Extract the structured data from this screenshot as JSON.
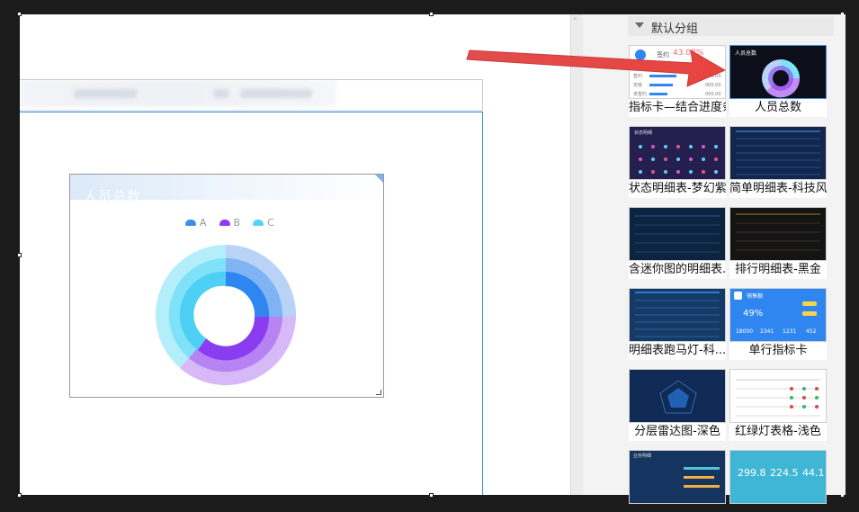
{
  "canvas": {
    "widget": {
      "title": "人员总数",
      "legend": [
        {
          "label": "A",
          "color": "#3a8ef0"
        },
        {
          "label": "B",
          "color": "#8a3df0"
        },
        {
          "label": "C",
          "color": "#54d3f5"
        }
      ]
    }
  },
  "panel": {
    "group_label": "默认分组",
    "tiles": [
      {
        "label": "指标卡—结合进度条",
        "thumb_text": {
          "name": "签约",
          "pct": "43.08%",
          "rows": [
            "签约",
            "定级",
            "未签约"
          ],
          "val": "000.00"
        }
      },
      {
        "label": "人员总数",
        "thumb_text": {
          "title": "人员总数"
        }
      },
      {
        "label": "状态明细表-梦幻紫",
        "thumb_text": {
          "title": "状态明细"
        }
      },
      {
        "label": "简单明细表-科技风"
      },
      {
        "label": "含迷你图的明细表..."
      },
      {
        "label": "排行明细表-黑金"
      },
      {
        "label": "明细表跑马灯-科..."
      },
      {
        "label": "单行指标卡",
        "thumb_text": {
          "name": "销售额",
          "pct": "49%",
          "nums": [
            "18000",
            "2341",
            "1231",
            "452"
          ]
        }
      },
      {
        "label": "分层雷达图-深色"
      },
      {
        "label": "红绿灯表格-浅色"
      },
      {
        "label": "",
        "thumb_text": {
          "title": "业务明细"
        }
      },
      {
        "label": "",
        "thumb_text": {
          "nums": [
            "299.8",
            "224.5",
            "44.1"
          ]
        }
      }
    ]
  },
  "icons": {
    "arrow": "red-arrow-icon",
    "caret": "caret-down-icon"
  }
}
